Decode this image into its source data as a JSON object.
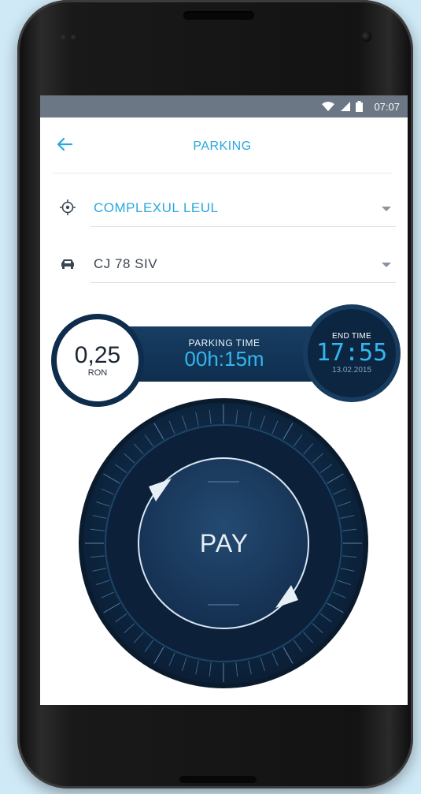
{
  "status_bar": {
    "time": "07:07",
    "icons": [
      "wifi-icon",
      "signal-icon",
      "battery-icon"
    ]
  },
  "header": {
    "title": "PARKING",
    "back_icon": "arrow-left-icon"
  },
  "location": {
    "value": "COMPLEXUL LEUL",
    "icon": "crosshair-icon"
  },
  "vehicle": {
    "value": "CJ 78 SIV",
    "icon": "car-icon"
  },
  "cost": {
    "amount": "0,25",
    "currency": "RON"
  },
  "parking_time": {
    "label": "PARKING TIME",
    "value": "00h:15m"
  },
  "end_time": {
    "label": "END TIME",
    "time": "17:55",
    "date": "13.02.2015"
  },
  "pay": {
    "label": "PAY"
  },
  "colors": {
    "accent": "#29a8de",
    "dark_navy": "#0e2c4c",
    "status_bar": "#6b7784"
  }
}
